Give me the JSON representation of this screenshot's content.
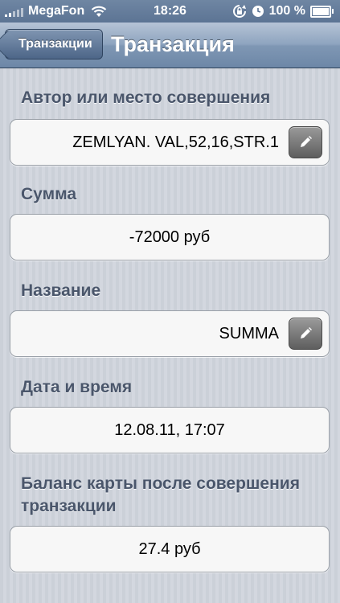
{
  "status_bar": {
    "carrier": "MegaFon",
    "time": "18:26",
    "battery": "100 %",
    "battery_level": 1.0,
    "icons": [
      "signal-icon",
      "wifi-icon",
      "rotation-lock-icon",
      "alarm-icon",
      "battery-icon"
    ]
  },
  "nav": {
    "back_label": "Транзакции",
    "title": "Транзакция"
  },
  "sections": [
    {
      "label": "Автор или место совершения",
      "value": "ZEMLYAN. VAL,52,16,STR.1",
      "editable": true
    },
    {
      "label": "Сумма",
      "value": "-72000 руб",
      "editable": false
    },
    {
      "label": "Название",
      "value": "SUMMA",
      "editable": true
    },
    {
      "label": "Дата и время",
      "value": "12.08.11, 17:07",
      "editable": false
    },
    {
      "label": "Баланс карты после совершения транзакции",
      "value": "27.4 руб",
      "editable": false
    }
  ],
  "colors": {
    "nav_bar": "#7f97b4",
    "section_label": "#4a566b",
    "background": "#cdd2da"
  }
}
